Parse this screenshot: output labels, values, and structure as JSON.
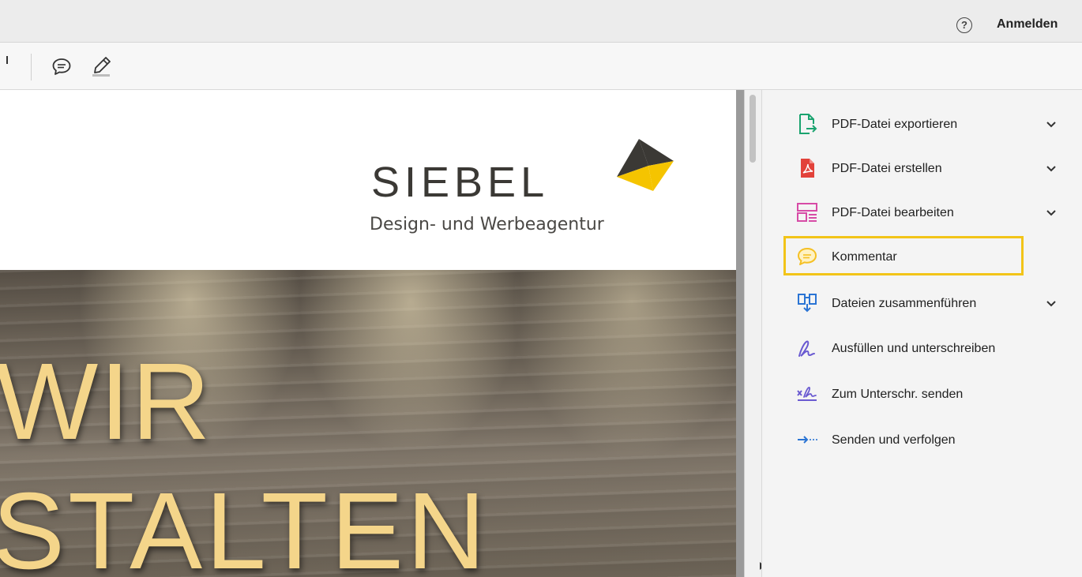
{
  "header": {
    "help_icon": "question-circle-icon",
    "help_glyph": "?",
    "signin_label": "Anmelden"
  },
  "toolbar": {
    "buttons": [
      {
        "icon": "comment-bubble-icon"
      },
      {
        "icon": "highlighter-pen-icon"
      }
    ]
  },
  "document": {
    "logo": {
      "wordmark": "SIEBEL",
      "tagline": "Design- und Werbeagentur",
      "mark_colors": [
        "#3b3935",
        "#f5c400"
      ]
    },
    "photo_text": {
      "line1": "WIR",
      "line2": "STALTEN",
      "color": "#f4d58a"
    }
  },
  "tools_panel": {
    "items": [
      {
        "label": "PDF-Datei exportieren",
        "icon": "export-pdf-icon",
        "color": "#1aa36f",
        "expandable": true
      },
      {
        "label": "PDF-Datei erstellen",
        "icon": "create-pdf-icon",
        "color": "#e2423a",
        "expandable": true
      },
      {
        "label": "PDF-Datei bearbeiten",
        "icon": "edit-pdf-icon",
        "color": "#d74ba6",
        "expandable": true
      },
      {
        "label": "Kommentar",
        "icon": "comment-icon",
        "color": "#f5c024",
        "expandable": false,
        "highlighted": true
      },
      {
        "label": "Dateien zusammenführen",
        "icon": "combine-files-icon",
        "color": "#2a74d4",
        "expandable": true
      },
      {
        "label": "Ausfüllen und unterschreiben",
        "icon": "fill-sign-icon",
        "color": "#6a5ad1",
        "expandable": false
      },
      {
        "label": "Zum Unterschr. senden",
        "icon": "send-for-signature-icon",
        "color": "#6a5ad1",
        "expandable": false
      },
      {
        "label": "Senden und verfolgen",
        "icon": "send-track-icon",
        "color": "#2a74d4",
        "expandable": false
      }
    ],
    "highlight_color": "#f2c418"
  }
}
